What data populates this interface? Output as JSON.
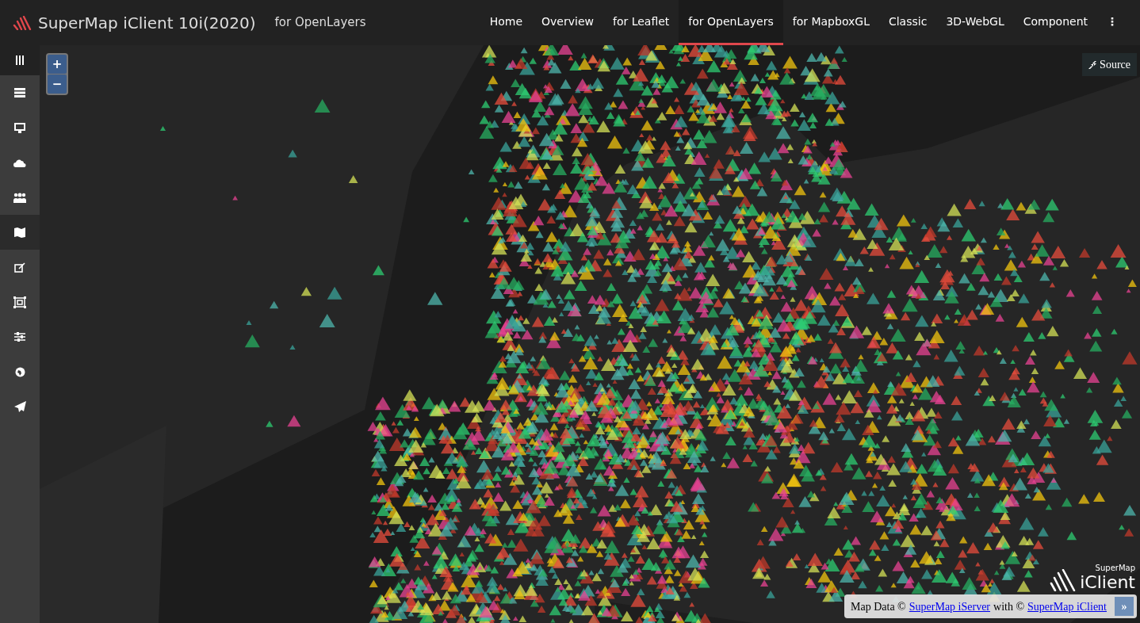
{
  "header": {
    "title": "SuperMap iClient 10i(2020)",
    "subtitle": "for OpenLayers"
  },
  "nav": [
    {
      "label": "Home",
      "selected": false
    },
    {
      "label": "Overview",
      "selected": false
    },
    {
      "label": "for Leaflet",
      "selected": false
    },
    {
      "label": "for OpenLayers",
      "selected": true
    },
    {
      "label": "for MapboxGL",
      "selected": false
    },
    {
      "label": "Classic",
      "selected": false
    },
    {
      "label": "3D-WebGL",
      "selected": false
    },
    {
      "label": "Component",
      "selected": false
    },
    {
      "label": "⋮",
      "selected": false
    }
  ],
  "sidebar": {
    "items": [
      {
        "selected": false
      },
      {
        "selected": false
      },
      {
        "selected": false
      },
      {
        "selected": false
      },
      {
        "selected": true
      },
      {
        "selected": false
      },
      {
        "selected": false
      },
      {
        "selected": false
      },
      {
        "selected": false
      },
      {
        "selected": false
      }
    ]
  },
  "map": {
    "zoom_in": "+",
    "zoom_out": "−",
    "source_button": "Source",
    "logo": {
      "top": "SuperMap",
      "bottom": "iClient"
    },
    "attribution": {
      "prefix": "Map Data ©",
      "link_1": "SuperMap iServer",
      "middle": "with ©",
      "link_2": "SuperMap iClient",
      "toggle": "»"
    }
  }
}
